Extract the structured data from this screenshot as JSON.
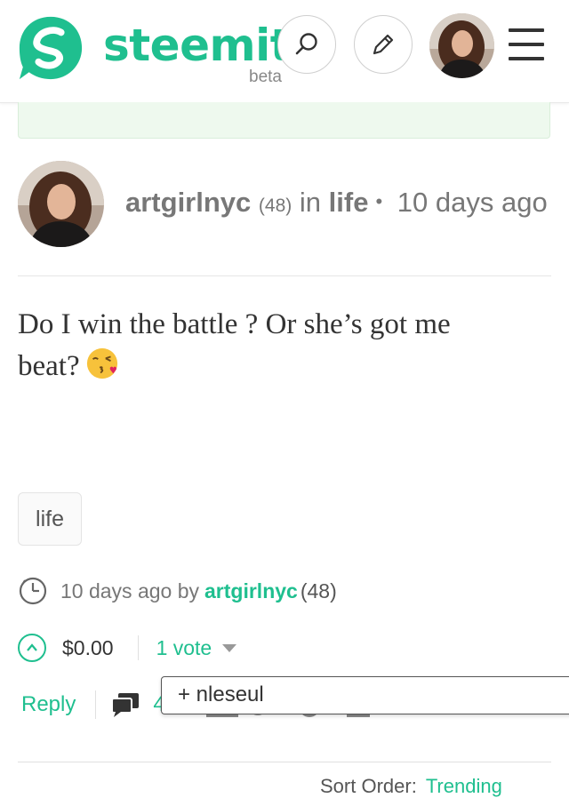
{
  "header": {
    "brand": "steemit",
    "brand_tag": "beta",
    "colors": {
      "accent": "#1fbf8f"
    },
    "icons": [
      "steemit-logo-icon",
      "search-icon",
      "pencil-icon",
      "menu-icon"
    ]
  },
  "post": {
    "author": "artgirlnyc",
    "author_rep": "(48)",
    "in_word": "in",
    "category": "life",
    "bullet": "•",
    "age": "10 days ago",
    "body_line1": "Do I win the battle ? Or she’s got me",
    "body_line2": "beat?",
    "emoji": "face-blowing-kiss",
    "tag": "life"
  },
  "footer": {
    "timestamp_text": "10 days ago by",
    "author": "artgirlnyc",
    "author_rep": "(48)",
    "payout": "$0.00",
    "votes_label": "1 vote",
    "reply_label": "Reply",
    "comment_count": "4"
  },
  "voters_tooltip": {
    "entry": "+ nleseul"
  },
  "comments_header_peek": {
    "sort_label": "Sort Order:",
    "sort_value": "Trending"
  }
}
